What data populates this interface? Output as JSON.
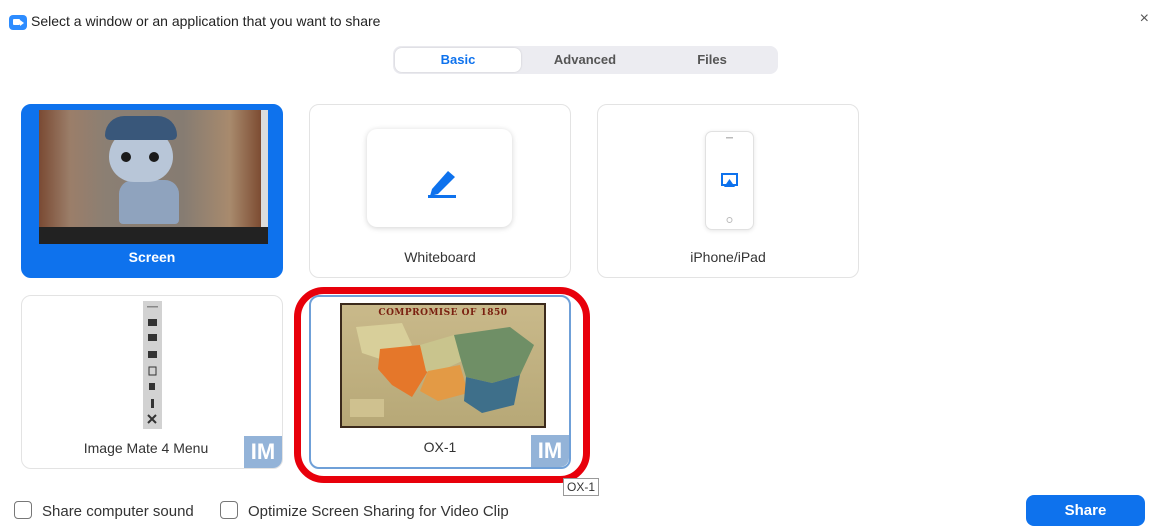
{
  "window": {
    "title": "Select a window or an application that you want to share",
    "close_glyph": "×"
  },
  "tabs": [
    {
      "label": "Basic",
      "active": true
    },
    {
      "label": "Advanced",
      "active": false
    },
    {
      "label": "Files",
      "active": false
    }
  ],
  "cards": {
    "screen": {
      "label": "Screen",
      "selected": true
    },
    "whiteboard": {
      "label": "Whiteboard"
    },
    "iphone": {
      "label": "iPhone/iPad"
    },
    "imagemate": {
      "label": "Image Mate 4 Menu",
      "badge": "IM"
    },
    "ox1": {
      "label": "OX-1",
      "badge": "IM",
      "thumbnail_title": "COMPROMISE OF 1850"
    }
  },
  "tooltip": "OX-1",
  "footer": {
    "share_sound": "Share computer sound",
    "optimize": "Optimize Screen Sharing for Video Clip",
    "share_button": "Share"
  },
  "colors": {
    "accent": "#0e72ed",
    "highlight": "#e8000b"
  }
}
